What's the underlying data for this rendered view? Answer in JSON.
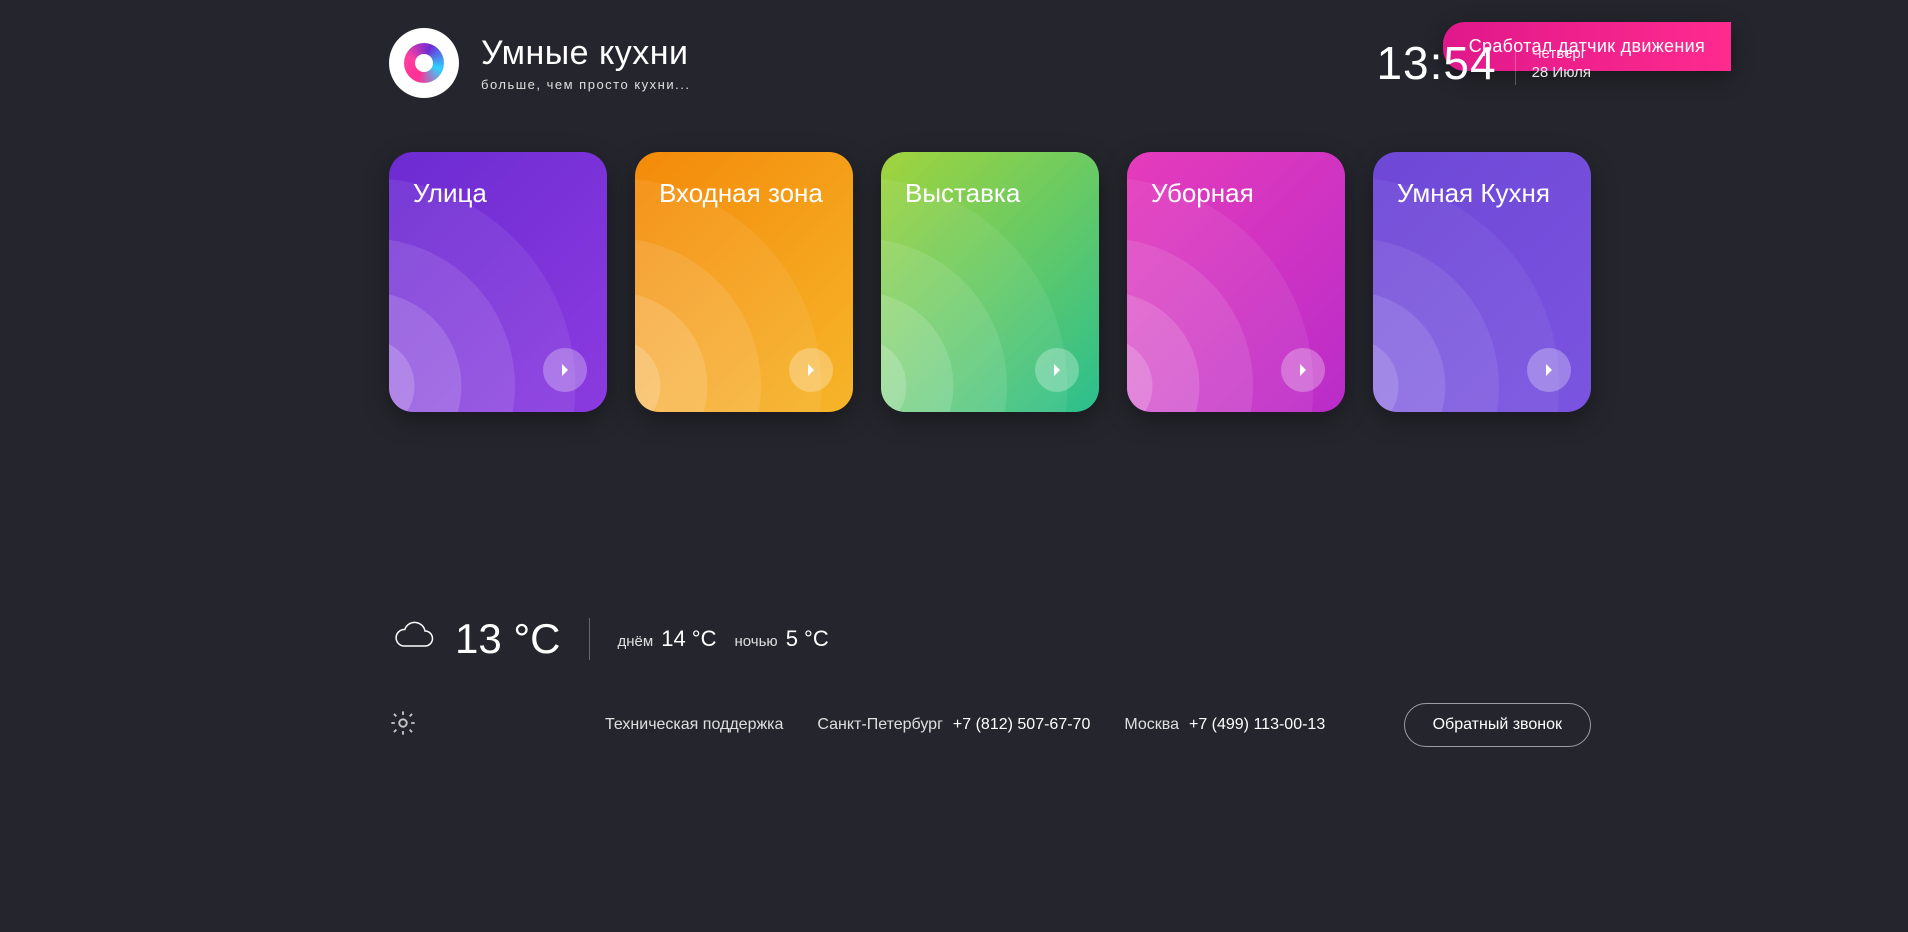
{
  "notification": {
    "text": "Сработал датчик движения"
  },
  "brand": {
    "title": "Умные кухни",
    "subtitle": "больше, чем просто кухни..."
  },
  "clock": {
    "time": "13:54",
    "weekday": "Четверг",
    "date": "28 Июля"
  },
  "cards": [
    {
      "title": "Улица"
    },
    {
      "title": "Входная зона"
    },
    {
      "title": "Выставка"
    },
    {
      "title": "Уборная"
    },
    {
      "title": "Умная Кухня"
    }
  ],
  "weather": {
    "now": "13 °C",
    "day_label": "днём",
    "day_value": "14 °C",
    "night_label": "ночью",
    "night_value": "5 °C"
  },
  "footer": {
    "support_label": "Техническая поддержка",
    "city1": "Санкт-Петербург",
    "phone1": "+7 (812) 507-67-70",
    "city2": "Москва",
    "phone2": "+7 (499) 113-00-13",
    "callback_label": "Обратный звонок"
  }
}
